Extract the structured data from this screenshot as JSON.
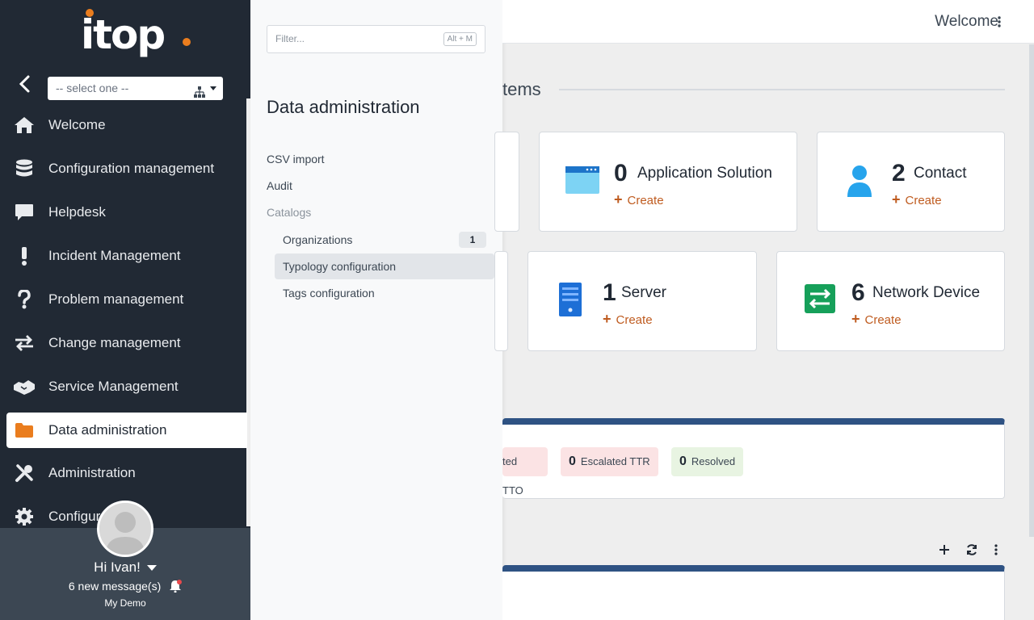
{
  "sidebar": {
    "logo_text": "itop",
    "org_select_value": "-- select one --",
    "items": [
      {
        "label": "Welcome",
        "icon": "home-icon"
      },
      {
        "label": "Configuration management",
        "icon": "database-icon"
      },
      {
        "label": "Helpdesk",
        "icon": "comment-icon"
      },
      {
        "label": "Incident Management",
        "icon": "exclamation-icon"
      },
      {
        "label": "Problem management",
        "icon": "question-icon"
      },
      {
        "label": "Change management",
        "icon": "exchange-icon"
      },
      {
        "label": "Service Management",
        "icon": "handshake-icon"
      },
      {
        "label": "Data administration",
        "icon": "folder-icon"
      },
      {
        "label": "Administration",
        "icon": "tools-icon"
      },
      {
        "label": "Configur",
        "icon": "gear-icon"
      }
    ],
    "active_index": 7
  },
  "user": {
    "greeting": "Hi Ivan!",
    "messages": "6 new message(s)",
    "org": "My Demo"
  },
  "flyout": {
    "filter_placeholder": "Filter...",
    "filter_shortcut": "Alt + M",
    "title": "Data administration",
    "links": {
      "csv_import": "CSV import",
      "audit": "Audit",
      "catalogs": "Catalogs"
    },
    "sub": {
      "organizations": "Organizations",
      "organizations_count": "1",
      "typology": "Typology configuration",
      "tags": "Tags configuration"
    }
  },
  "topbar": {
    "welcome": "Welcome"
  },
  "main": {
    "section_title": "tems",
    "cards": {
      "app_solution": {
        "count": "0",
        "name": "Application Solution",
        "create": "Create"
      },
      "contact": {
        "count": "2",
        "name": "Contact",
        "create": "Create"
      },
      "server": {
        "count": "1",
        "name": "Server",
        "create": "Create"
      },
      "network_device": {
        "count": "6",
        "name": "Network Device",
        "create": "Create"
      }
    },
    "badges": {
      "escalated_tto": "ted TTO",
      "escalated_ttr_count": "0",
      "escalated_ttr": "Escalated TTR",
      "resolved_count": "0",
      "resolved": "Resolved"
    }
  },
  "colors": {
    "sidebar_bg": "#212934",
    "accent": "#ea7d1e",
    "create": "#bf5b1f",
    "dashlet_header": "#2e5283",
    "network_green": "#16a05a",
    "server_blue": "#1d6fd6",
    "contact_blue": "#27a4ec"
  }
}
